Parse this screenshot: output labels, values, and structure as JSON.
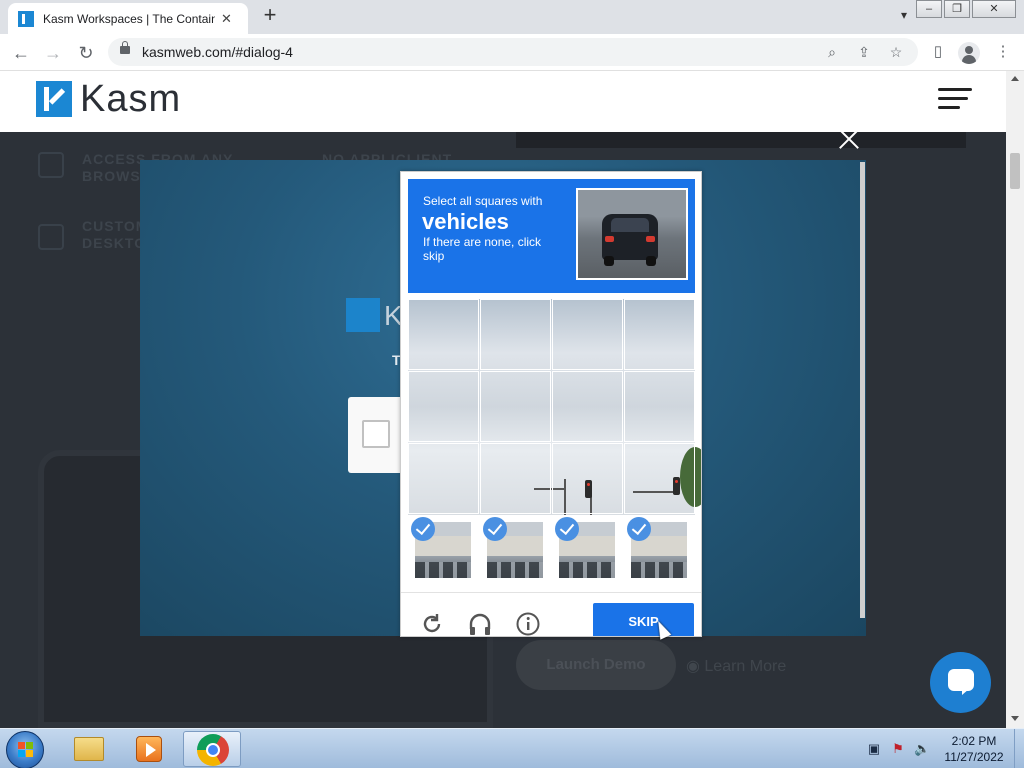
{
  "browser": {
    "tab_title": "Kasm Workspaces | The Containe",
    "tab_close": "✕",
    "new_tab": "+",
    "url": "kasmweb.com/#dialog-4",
    "window_buttons": {
      "minimize": "‒",
      "restore": "❐",
      "close": "✕"
    }
  },
  "site": {
    "logo_text": "Kasm",
    "faded_features": [
      "ACCESS FROM ANY",
      "BROWSER",
      "NO APPLICLIENT",
      "CUSTOM",
      "DESKTOP"
    ],
    "launch_demo": "Launch Demo",
    "learn_more": "Learn More",
    "inner_logo_text": "K",
    "inner_t": "T"
  },
  "captcha": {
    "instruction_line1": "Select all squares with",
    "object": "vehicles",
    "instruction_line3": "If there are none, click skip",
    "skip_label": "SKIP",
    "selected_tiles": 4,
    "grid": "3x4"
  },
  "taskbar": {
    "time": "2:02 PM",
    "date": "11/27/2022"
  },
  "colors": {
    "captcha_blue": "#1a73e8",
    "kasm_blue": "#1b87d3",
    "chat_blue": "#1e7fd1"
  }
}
